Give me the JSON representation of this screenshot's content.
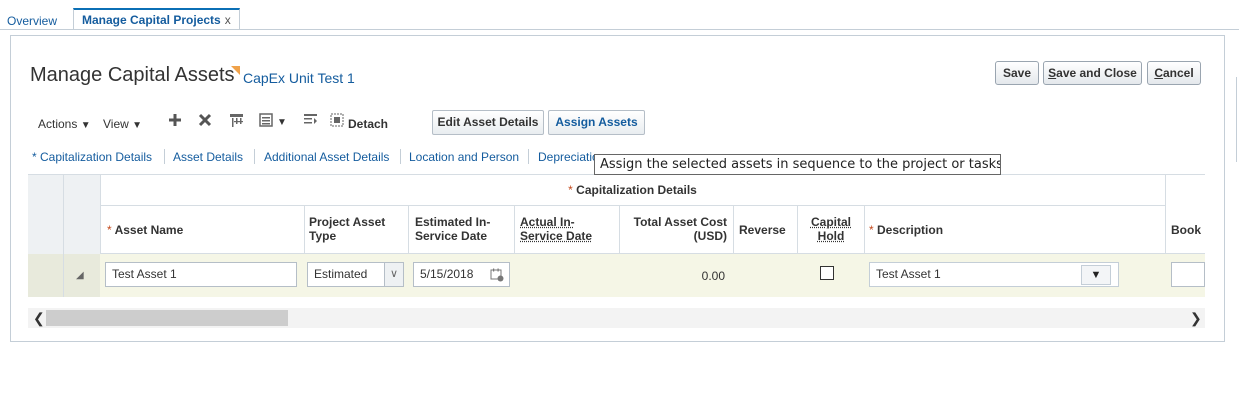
{
  "tabs": {
    "overview": "Overview",
    "active": "Manage Capital Projects",
    "close": "x"
  },
  "header": {
    "title": "Manage Capital Assets",
    "subtitle": "CapEx Unit Test 1",
    "save": "Save",
    "save_close_s": "S",
    "save_close_rest": "ave and Close",
    "cancel_c": "C",
    "cancel_rest": "ancel"
  },
  "toolbar": {
    "actions": "Actions",
    "view": "View",
    "detach": "Detach",
    "edit_asset_details": "Edit Asset Details",
    "assign_assets": "Assign Assets",
    "caret": "▼"
  },
  "subtabs": [
    "* Capitalization Details",
    "Asset Details",
    "Additional Asset Details",
    "Location and Person",
    "Depreciatio"
  ],
  "tooltip": "Assign the selected assets in sequence to the project or tasks",
  "table": {
    "group_header": "Capitalization Details",
    "columns": {
      "asset_name": "Asset Name",
      "project_asset_type_1": "Project Asset",
      "project_asset_type_2": "Type",
      "est_date_1": "Estimated In-",
      "est_date_2": "Service Date",
      "actual_date_1": "Actual In-",
      "actual_date_2": "Service Date",
      "total_cost_1": "Total Asset Cost",
      "total_cost_2": "(USD)",
      "reverse": "Reverse",
      "capital_hold_1": "Capital",
      "capital_hold_2": "Hold",
      "description": "Description",
      "book": "Book"
    },
    "row": {
      "asset_name": "Test Asset 1",
      "project_asset_type": "Estimated",
      "estimated_date": "5/15/2018",
      "total_cost": "0.00",
      "capital_hold": false,
      "description": "Test Asset 1"
    }
  },
  "icons": {
    "add": "plus-icon",
    "delete": "x-icon",
    "freeze": "freeze-icon",
    "columns": "columns-icon",
    "wrap": "wrap-icon",
    "detach": "detach-icon",
    "calendar": "calendar-icon"
  },
  "colors": {
    "link": "#145c9e",
    "active_tab_border": "#0b6fb5",
    "row_highlight": "#f5f6e6",
    "required": "#c3491c"
  }
}
